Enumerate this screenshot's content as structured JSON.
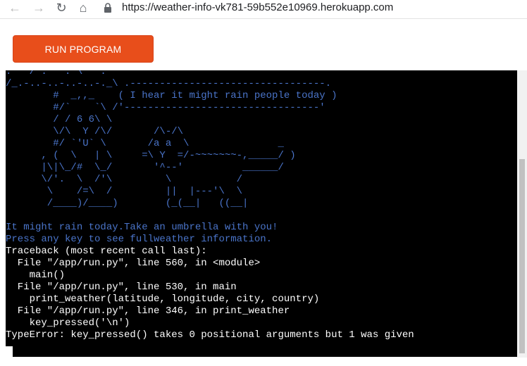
{
  "browser": {
    "url": "https://weather-info-vk781-59b552e10969.herokuapp.com",
    "back_icon": "←",
    "forward_icon": "→",
    "reload_icon": "↻",
    "home_icon": "⌂"
  },
  "toolbar": {
    "run_label": "RUN PROGRAM"
  },
  "colors": {
    "button": "#e84e1b",
    "terminal_bg": "#000000",
    "ascii_text": "#4a74c9",
    "traceback_text": "#ffffff"
  },
  "terminal": {
    "ascii_art": [
      ".'  / . ' . \\  '.",
      "/_.-..-..-..-..-._\\ .---------------------------------.",
      "        #  _,,_    ( I hear it might rain people today )",
      "        #/`    `\\ /'---------------------------------'",
      "        / / 6 6\\ \\",
      "        \\/\\  Y /\\/       /\\-/\\",
      "        #/ `'U` \\       /a a  \\               _",
      "      , (  \\   | \\     =\\ Y  =/-~~~~~~~-,_____/ )",
      "      |\\|\\_/#  \\_/       '^--'          ______/",
      "      \\/'.  \\  /'\\         \\           /",
      "       \\    /=\\  /         ||  |---'\\  \\",
      "       /____)/____)        (_(__|   ((__|"
    ],
    "messages": [
      "It might rain today.Take an umbrella with you!",
      "Press any key to see fullweather information."
    ],
    "traceback": [
      "Traceback (most recent call last):",
      "  File \"/app/run.py\", line 560, in <module>",
      "    main()",
      "  File \"/app/run.py\", line 530, in main",
      "    print_weather(latitude, longitude, city, country)",
      "  File \"/app/run.py\", line 346, in print_weather",
      "    key_pressed('\\n')",
      "TypeError: key_pressed() takes 0 positional arguments but 1 was given"
    ]
  }
}
